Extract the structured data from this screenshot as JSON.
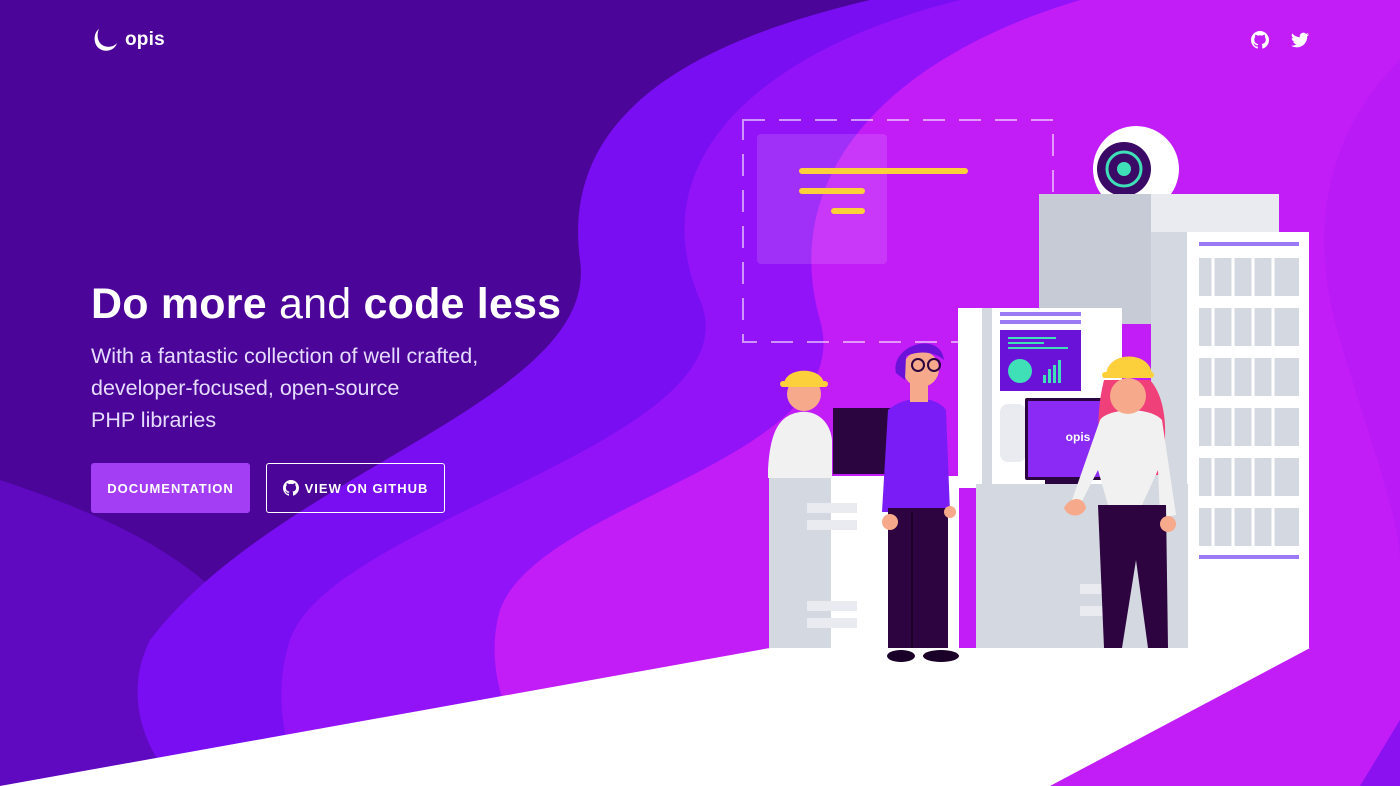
{
  "header": {
    "logo_text": "opis",
    "social": [
      {
        "icon": "github-icon"
      },
      {
        "icon": "twitter-icon"
      }
    ]
  },
  "hero": {
    "headline_bold_1": "Do more",
    "headline_normal": "and",
    "headline_bold_2": "code less",
    "subline_1": "With a fantastic collection of well crafted,",
    "subline_2": "developer-focused, open-source",
    "subline_3": "PHP libraries"
  },
  "buttons": {
    "documentation_label": "DOCUMENTATION",
    "github_label": "VIEW ON GITHUB"
  },
  "illustration": {
    "monitor_text": "opis"
  },
  "colors": {
    "background_dark": "#4a0596",
    "background_magenta": "#c21cf7",
    "accent_purple": "#a43ef5",
    "hardhat_yellow": "#fcd03a",
    "white": "#ffffff"
  }
}
